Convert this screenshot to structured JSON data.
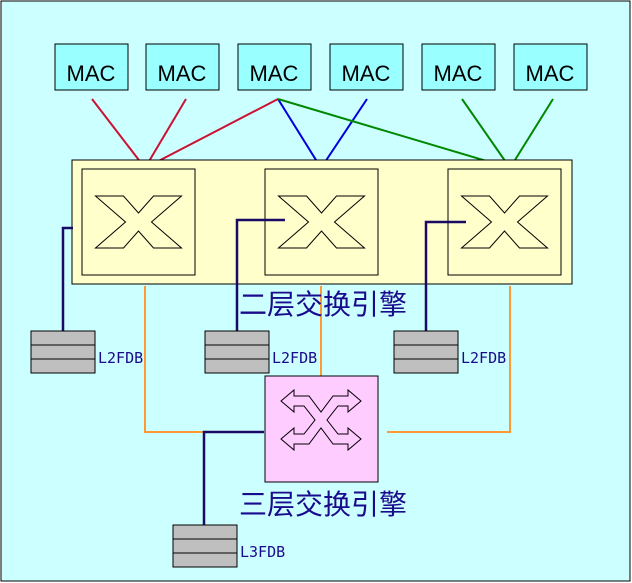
{
  "mac_ports": [
    "MAC",
    "MAC",
    "MAC",
    "MAC",
    "MAC",
    "MAC"
  ],
  "l2_engine": {
    "label": "二层交换引擎"
  },
  "l3_engine": {
    "label": "三层交换引擎"
  },
  "l2fdb": [
    "L2FDB",
    "L2FDB",
    "L2FDB"
  ],
  "l3fdb": {
    "label": "L3FDB"
  },
  "colors": {
    "background": "#ccffff",
    "mac_fill": "#99ffff",
    "engine_fill": "#ffffcc",
    "l3_fill": "#ffccff",
    "red_link": "#cc1133",
    "blue_link": "#0000dd",
    "green_link": "#008800",
    "orange_link": "#ff9933",
    "fdb_link": "#1a0a66",
    "label_color": "#1a0a8c",
    "db_fill": "#bfbfbf"
  }
}
